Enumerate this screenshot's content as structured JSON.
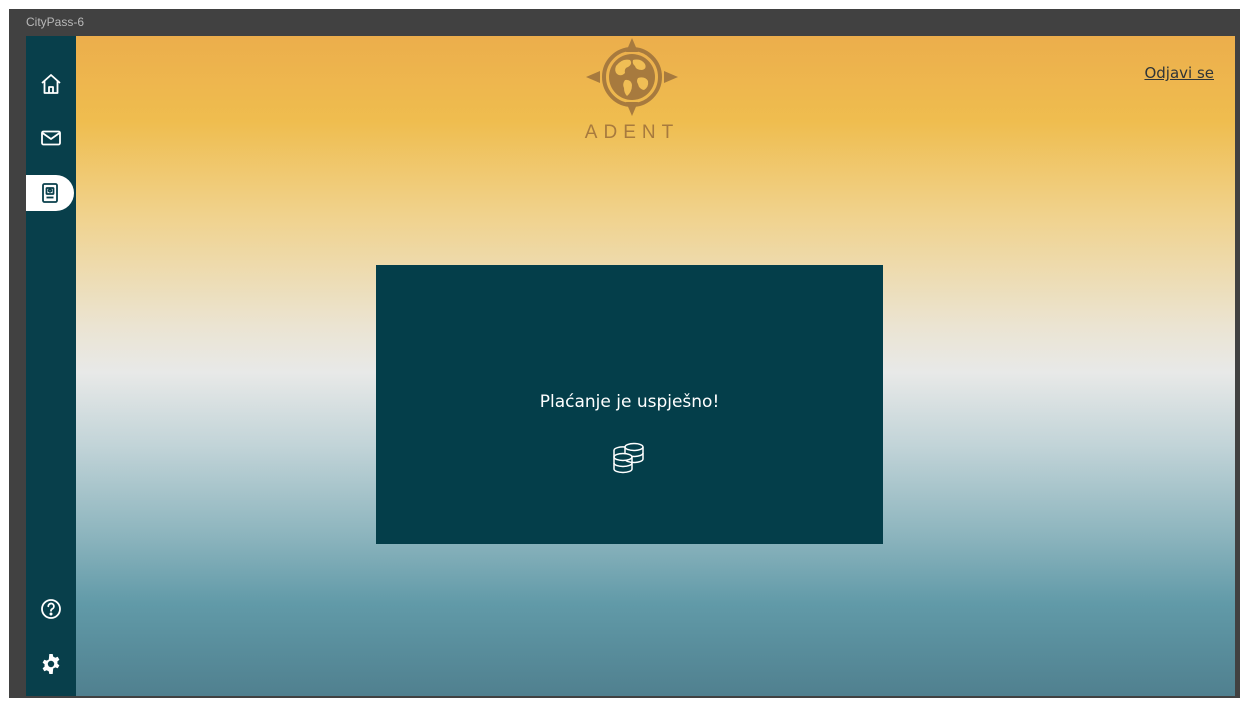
{
  "window": {
    "title": "CityPass-6"
  },
  "sidebar": {
    "items": [
      {
        "icon": "home-icon"
      },
      {
        "icon": "mail-icon"
      },
      {
        "icon": "id-card-icon",
        "active": true
      },
      {
        "icon": "help-icon"
      },
      {
        "icon": "gear-icon"
      }
    ]
  },
  "header": {
    "logo_text": "ADENT",
    "logout_label": "Odjavi se"
  },
  "dialog": {
    "message": "Plaćanje je uspješno!",
    "icon": "coins-icon"
  },
  "colors": {
    "sidebar": "#083f4b",
    "dialog": "#043e4a",
    "logo": "#a77a3e",
    "window_frame": "#414141"
  }
}
